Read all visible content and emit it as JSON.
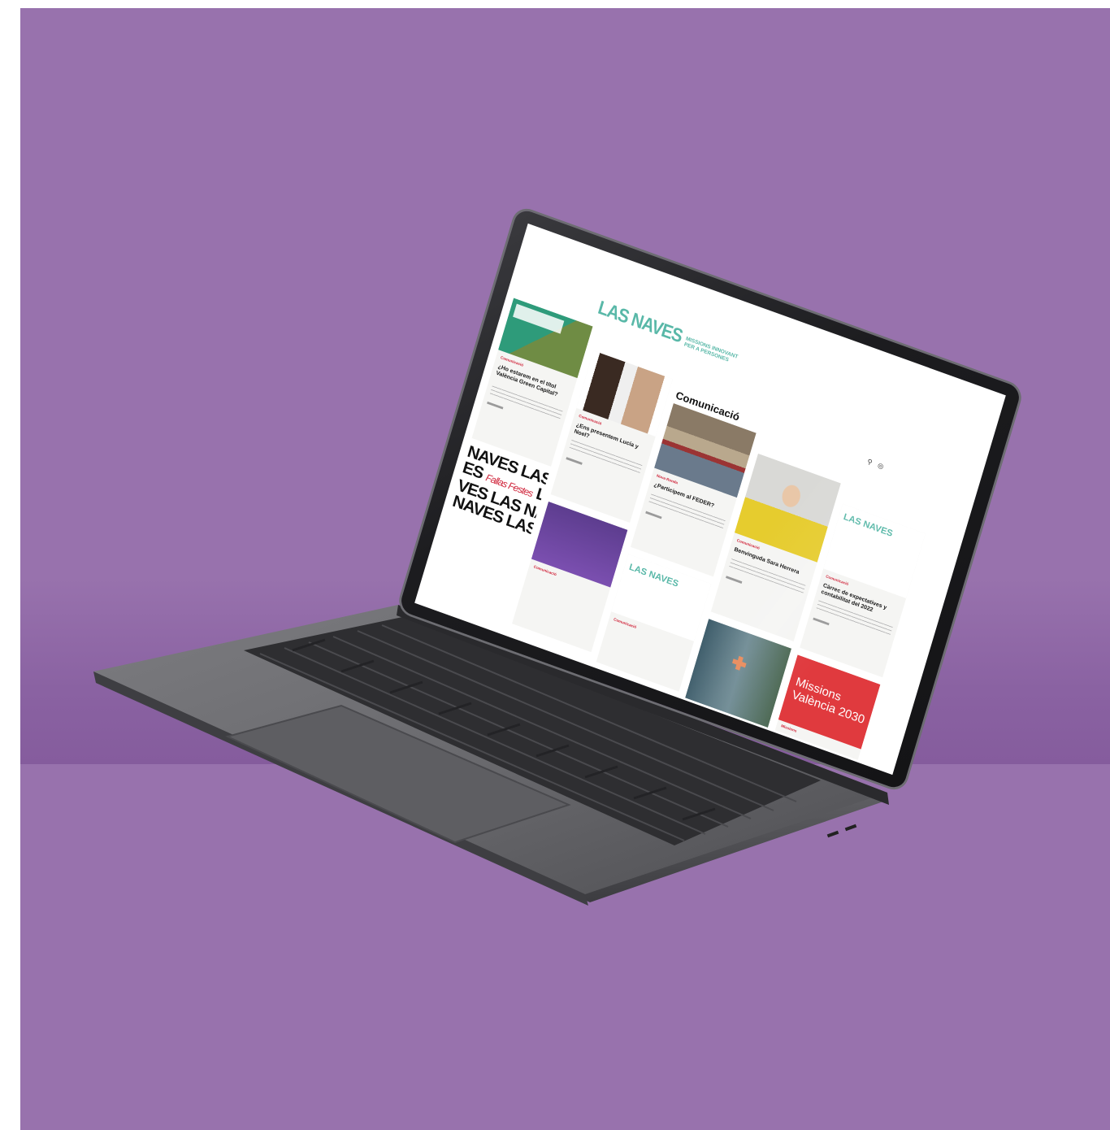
{
  "scene": {
    "background_color": "#9872ad",
    "device": "laptop",
    "device_color": "#5a5a5e"
  },
  "site": {
    "logo": {
      "main": "LAS NAVES",
      "sub_line1": "MISSIONS INNOVANT",
      "sub_line2": "PER A PERSONES"
    },
    "page_title": "Comunicació",
    "header_icons": [
      "search-icon",
      "globe-icon"
    ],
    "accent_color": "#59b8a8",
    "category_color": "#d0243a",
    "cards": [
      {
        "category": "Comunicació",
        "title": "¿Ho estarem en el títol València Green Capital?"
      },
      {
        "category": "Comunicació",
        "title": "¿Ens presentem Lucía y Noel?"
      },
      {
        "category": "Nova Ronda",
        "title": "¿Participem al FEDER?"
      },
      {
        "category": "Comunicació",
        "title": "Benvinguda Sara Herrera"
      },
      {
        "category": "Comunicació",
        "title": "Càrrec de expectatives y contabilitat del 2022"
      },
      {
        "category": "Comunicació",
        "title": ""
      },
      {
        "category": "Comunicació",
        "title": ""
      },
      {
        "category": "Missions",
        "title": ""
      }
    ],
    "poster_words": [
      "NAVES LAS NAV",
      "ES",
      "VES LAS NAVES",
      "NAVES LAS NAVE",
      "Fallas Festes",
      "LA"
    ],
    "missions_poster": {
      "line1": "Missions",
      "line2": "València 2030"
    },
    "teal_logo_small": "LAS NAVES"
  }
}
